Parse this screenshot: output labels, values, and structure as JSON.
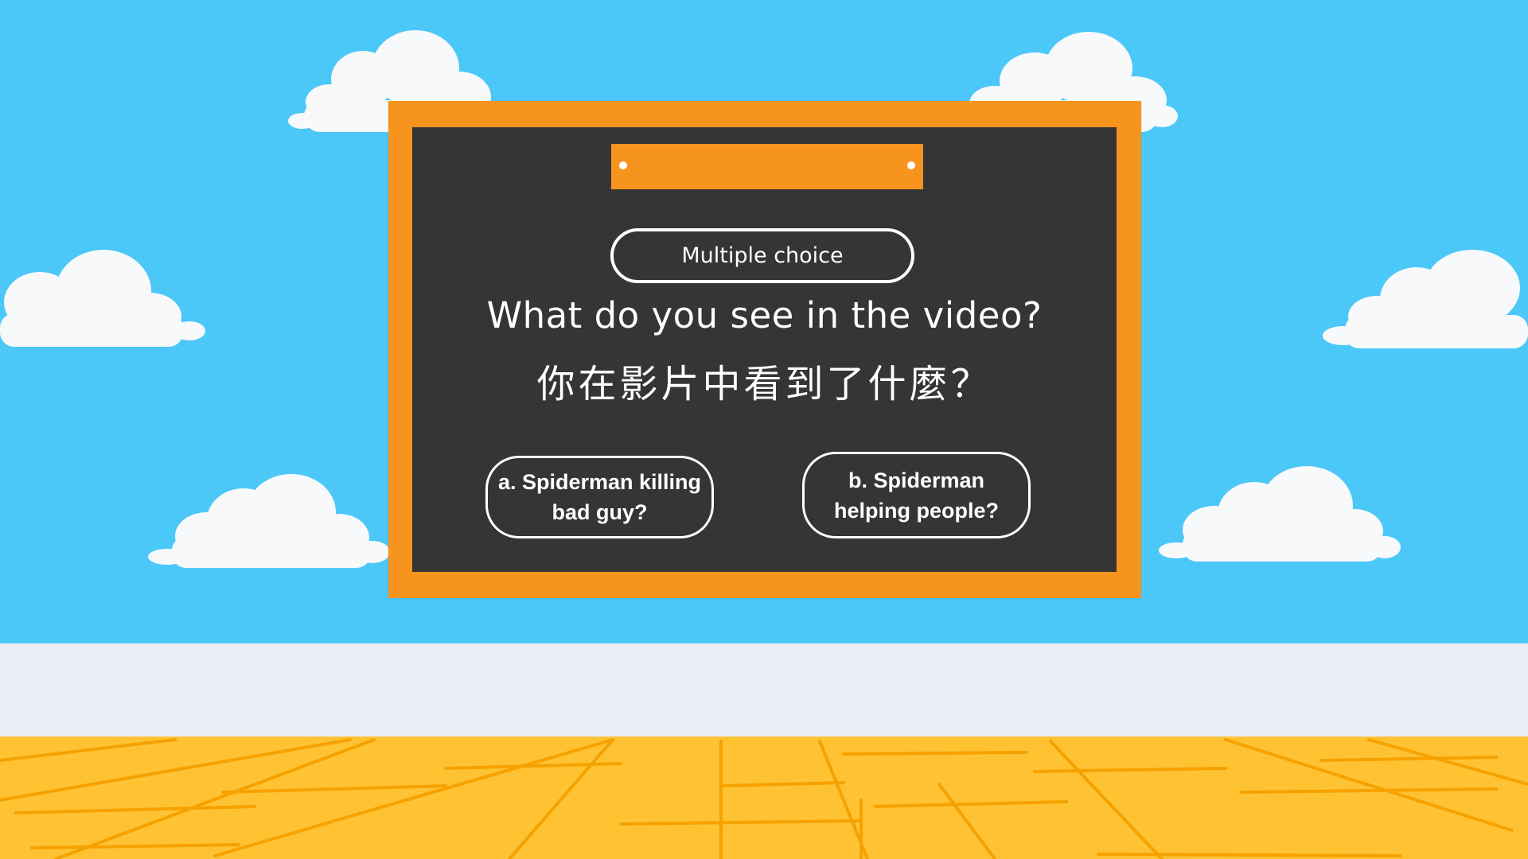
{
  "scene": {
    "colors": {
      "sky": "#4CC8F8",
      "wall_strip": "#EAECF6",
      "floor": "#FFC233",
      "floor_lines": "#F5A200",
      "cloud": "#F7F9FB",
      "frame": "#F7941E",
      "board": "#353535",
      "header_bar": "#F7941E",
      "rivet": "#FFFFFF",
      "outline": "#FFFFFF"
    }
  },
  "board": {
    "mode_label": "Multiple choice",
    "question_en": "What do you see in the video?",
    "question_zh": "你在影片中看到了什麼？"
  },
  "answers": [
    {
      "label": "a. Spiderman killing bad guy?"
    },
    {
      "label": "b. Spiderman helping people?"
    }
  ]
}
